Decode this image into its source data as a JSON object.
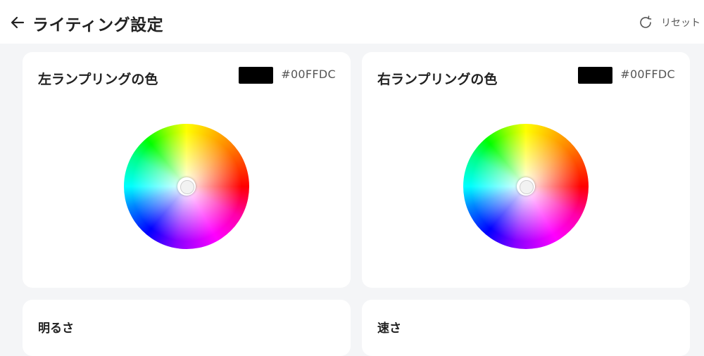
{
  "header": {
    "title": "ライティング設定",
    "back_icon": "arrow-left-icon",
    "reset_icon": "rotate-cw-icon",
    "reset_label": "リセット"
  },
  "left_lamp": {
    "title": "左ランプリングの色",
    "swatch_color": "#000000",
    "hex_value": "#00FFDC"
  },
  "right_lamp": {
    "title": "右ランプリングの色",
    "swatch_color": "#000000",
    "hex_value": "#00FFDC"
  },
  "brightness": {
    "title": "明るさ"
  },
  "speed": {
    "title": "速さ"
  }
}
